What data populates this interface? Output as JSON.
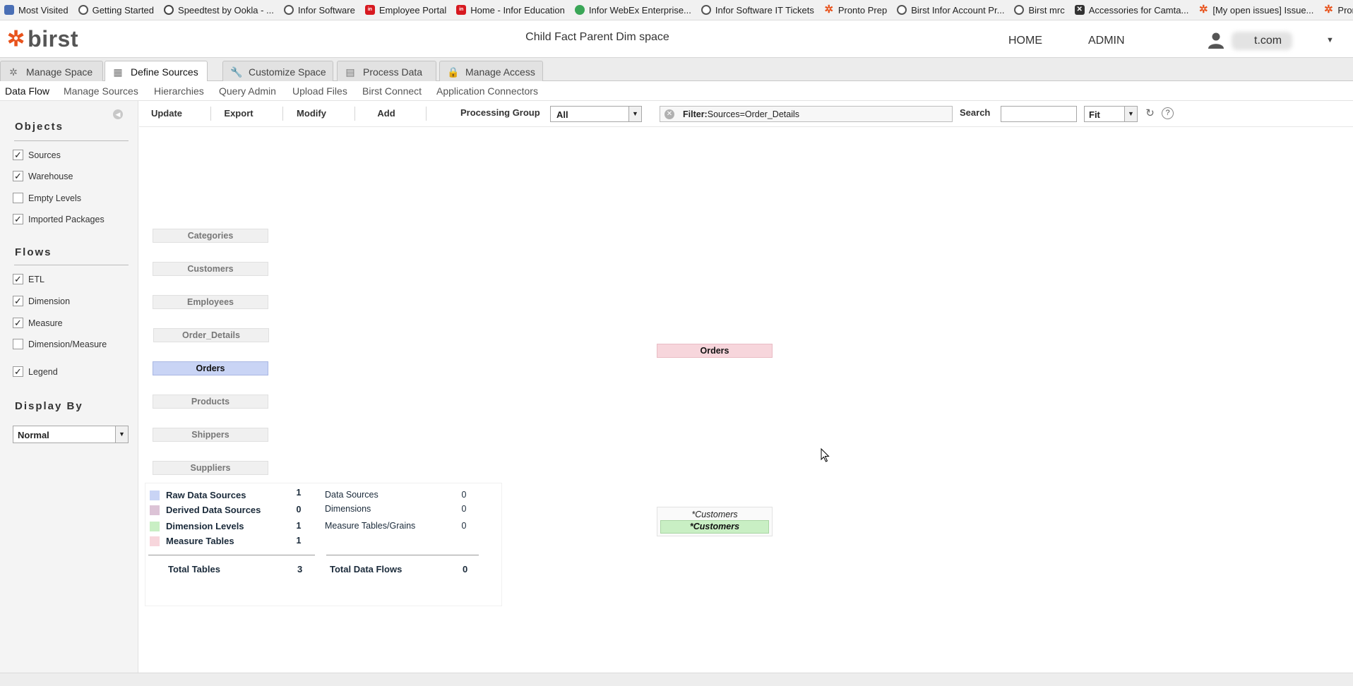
{
  "bookmarks": [
    {
      "label": "Most Visited",
      "icon": "folder-icon"
    },
    {
      "label": "Getting Started",
      "icon": "globe-icon"
    },
    {
      "label": "Speedtest by Ookla - ...",
      "icon": "speedometer-icon"
    },
    {
      "label": "Infor Software",
      "icon": "globe-icon"
    },
    {
      "label": "Employee Portal",
      "icon": "infor-icon"
    },
    {
      "label": "Home - Infor Education",
      "icon": "infor-icon"
    },
    {
      "label": "Infor WebEx Enterprise...",
      "icon": "webex-icon"
    },
    {
      "label": "Infor Software IT Tickets",
      "icon": "globe-icon"
    },
    {
      "label": "Pronto Prep",
      "icon": "birst-icon"
    },
    {
      "label": "Birst Infor Account Pr...",
      "icon": "globe-icon"
    },
    {
      "label": "Birst mrc",
      "icon": "globe-icon"
    },
    {
      "label": "Accessories for Camta...",
      "icon": "x-icon"
    },
    {
      "label": "[My open issues] Issue...",
      "icon": "birst-icon"
    },
    {
      "label": "Pronto QA live",
      "icon": "birst-icon"
    }
  ],
  "header": {
    "logo_text": "birst",
    "space_title": "Child Fact Parent Dim space",
    "nav_home": "HOME",
    "nav_admin": "ADMIN",
    "user_name": "t.com"
  },
  "tabs": [
    {
      "label": "Manage Space",
      "icon": "gear-icon",
      "active": false
    },
    {
      "label": "Define Sources",
      "icon": "grid-icon",
      "active": true
    },
    {
      "label": "Customize Space",
      "icon": "wrench-icon",
      "active": false
    },
    {
      "label": "Process Data",
      "icon": "database-icon",
      "active": false
    },
    {
      "label": "Manage Access",
      "icon": "lock-icon",
      "active": false
    }
  ],
  "subnav": [
    "Data Flow",
    "Manage Sources",
    "Hierarchies",
    "Query Admin",
    "Upload Files",
    "Birst Connect",
    "Application Connectors"
  ],
  "sidebar": {
    "objects_title": "Objects",
    "objects": [
      {
        "label": "Sources",
        "checked": true
      },
      {
        "label": "Warehouse",
        "checked": true
      },
      {
        "label": "Empty Levels",
        "checked": false
      },
      {
        "label": "Imported Packages",
        "checked": true
      }
    ],
    "flows_title": "Flows",
    "flows": [
      {
        "label": "ETL",
        "checked": true
      },
      {
        "label": "Dimension",
        "checked": true
      },
      {
        "label": "Measure",
        "checked": true
      },
      {
        "label": "Dimension/Measure",
        "checked": false
      },
      {
        "label": "Legend",
        "checked": true
      }
    ],
    "display_title": "Display By",
    "display_value": "Normal",
    "check_mark": "✓"
  },
  "toolbar": {
    "update": "Update",
    "export": "Export",
    "modify": "Modify",
    "add": "Add",
    "processing_group_label": "Processing Group",
    "processing_group_value": "All",
    "filter_prefix": "Filter:",
    "filter_value": "Sources=Order_Details",
    "search_label": "Search",
    "search_value": "",
    "fit_value": "Fit"
  },
  "sources": [
    "Categories",
    "Customers",
    "Employees",
    "Order_Details",
    "Orders",
    "Products",
    "Shippers",
    "Suppliers"
  ],
  "active_source": "Orders",
  "measure_node": "Orders",
  "dimension": {
    "header": "*Customers",
    "node": "*Customers"
  },
  "legend": {
    "rows": [
      {
        "label": "Raw Data Sources",
        "count": "1",
        "color": "#c9d4f5"
      },
      {
        "label": "Derived Data Sources",
        "count": "0",
        "color": "#dcc3d6"
      },
      {
        "label": "Dimension Levels",
        "count": "1",
        "color": "#c9efc4"
      },
      {
        "label": "Measure Tables",
        "count": "1",
        "color": "#f7d6dc"
      }
    ],
    "rows2": [
      {
        "label": "Data Sources",
        "count": "0"
      },
      {
        "label": "Dimensions",
        "count": "0"
      },
      {
        "label": "Measure Tables/Grains",
        "count": "0"
      }
    ],
    "total_tables_label": "Total Tables",
    "total_tables": "3",
    "total_flows_label": "Total Data Flows",
    "total_flows": "0"
  },
  "colors": {
    "brand": "#e8521b",
    "raw_source": "#c9d4f5",
    "dimension": "#c9efc4",
    "measure": "#f7d6dc"
  }
}
